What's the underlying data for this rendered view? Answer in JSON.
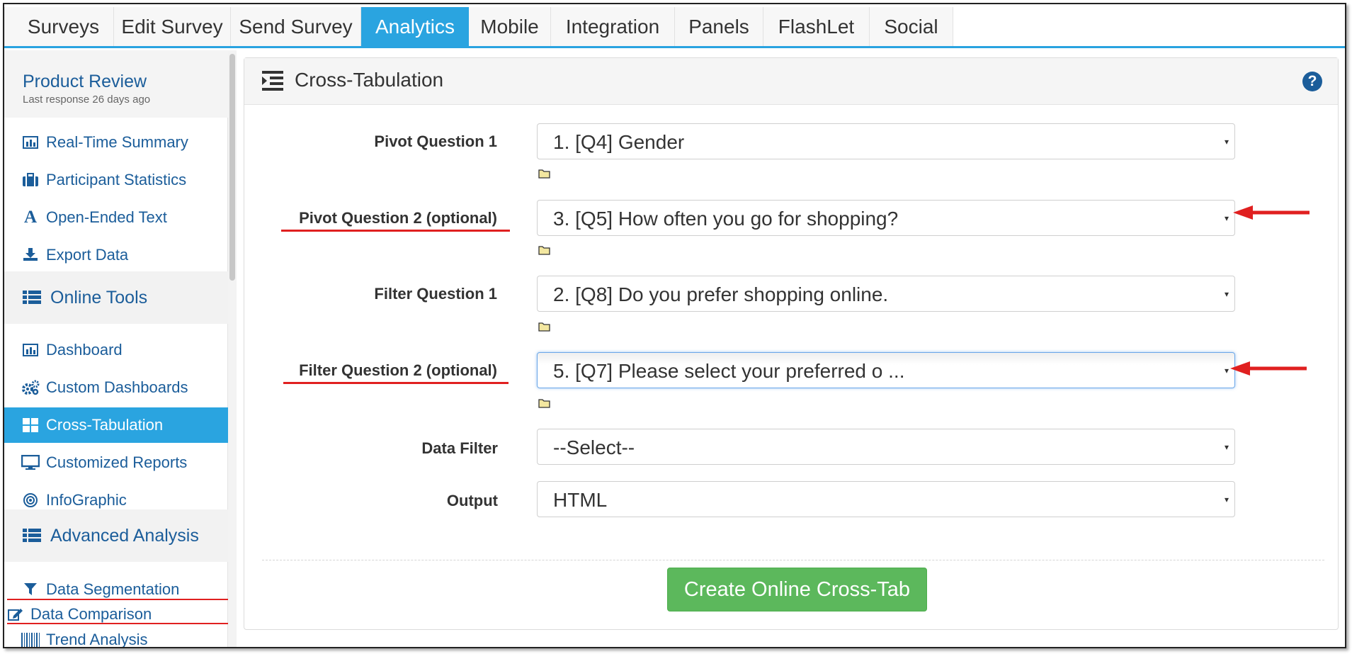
{
  "topnav": {
    "tabs": [
      {
        "label": "Surveys"
      },
      {
        "label": "Edit Survey"
      },
      {
        "label": "Send Survey"
      },
      {
        "label": "Analytics",
        "active": true
      },
      {
        "label": "Mobile"
      },
      {
        "label": "Integration"
      },
      {
        "label": "Panels"
      },
      {
        "label": "FlashLet"
      },
      {
        "label": "Social"
      }
    ]
  },
  "sidebar": {
    "survey_title": "Product Review",
    "survey_subtitle": "Last response 26 days ago",
    "items": [
      {
        "label": "Real-Time Summary",
        "icon": "bar-chart-icon"
      },
      {
        "label": "Participant Statistics",
        "icon": "briefcase-icon"
      },
      {
        "label": "Open-Ended Text",
        "icon": "font-icon"
      },
      {
        "label": "Export Data",
        "icon": "download-icon"
      }
    ],
    "sections": [
      {
        "label": "Online Tools",
        "icon": "list-icon"
      },
      {
        "label": "Advanced Analysis",
        "icon": "list-icon"
      }
    ],
    "online_tools": [
      {
        "label": "Dashboard",
        "icon": "bar-chart-icon"
      },
      {
        "label": "Custom Dashboards",
        "icon": "cogs-icon"
      },
      {
        "label": "Cross-Tabulation",
        "icon": "grid-icon",
        "active": true
      },
      {
        "label": "Customized Reports",
        "icon": "monitor-icon"
      },
      {
        "label": "InfoGraphic",
        "icon": "target-icon"
      }
    ],
    "advanced": [
      {
        "label": "Data Segmentation",
        "icon": "filter-icon"
      },
      {
        "label": "Data Comparison",
        "icon": "edit-icon"
      },
      {
        "label": "Trend Analysis",
        "icon": "barcode-icon"
      }
    ]
  },
  "main": {
    "title": "Cross-Tabulation",
    "fields": [
      {
        "label": "Pivot Question 1",
        "value": "1. [Q4] Gender"
      },
      {
        "label": "Pivot Question 2 (optional)",
        "value": "3. [Q5] How often you go for shopping?"
      },
      {
        "label": "Filter Question 1",
        "value": "2. [Q8] Do you prefer shopping online."
      },
      {
        "label": "Filter Question 2 (optional)",
        "value": "5. [Q7] Please select your preferred o ..."
      },
      {
        "label": "Data Filter",
        "value": "--Select--"
      },
      {
        "label": "Output",
        "value": "HTML"
      }
    ],
    "create_button": "Create Online Cross-Tab"
  },
  "colors": {
    "accent": "#2aa4e0",
    "link": "#1b5d9a",
    "button": "#5cb85c",
    "annotation": "#e02020"
  }
}
